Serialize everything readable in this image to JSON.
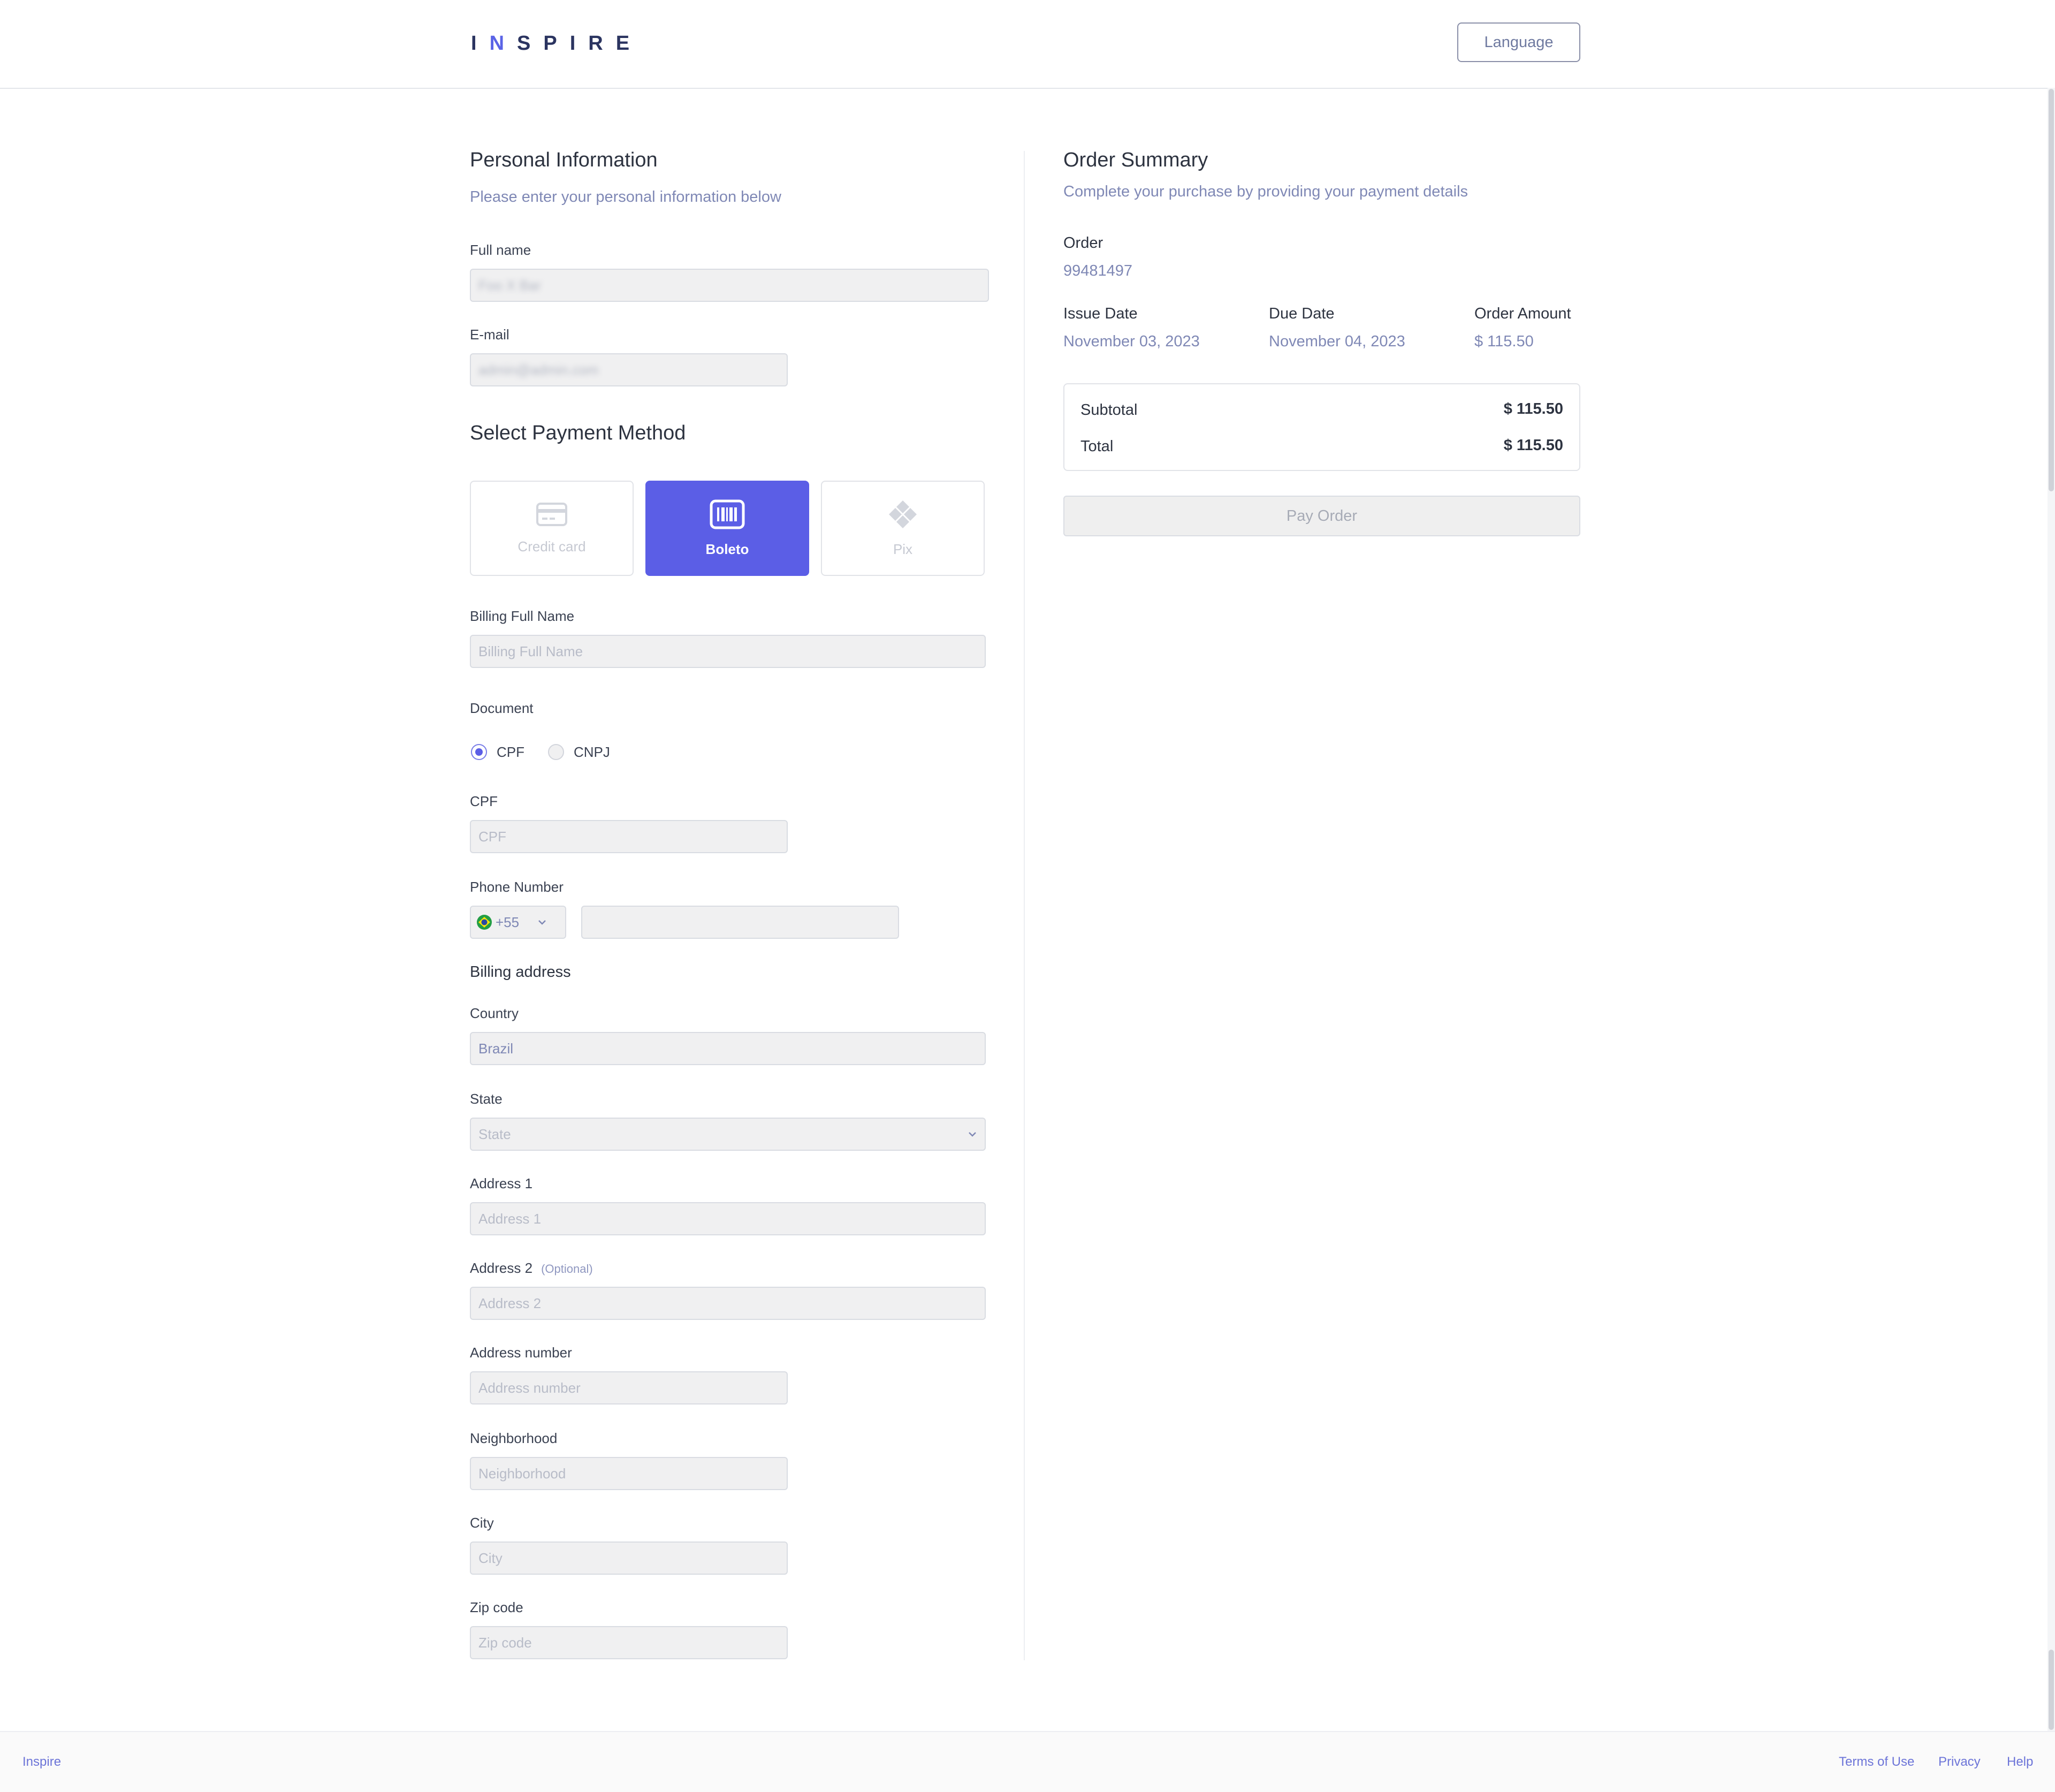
{
  "header": {
    "logo_part1": "I",
    "logo_accent": "N",
    "logo_part2": "SPIRE",
    "language_label": "Language"
  },
  "personal": {
    "title": "Personal Information",
    "subtitle": "Please enter your personal information below",
    "fullname_label": "Full name",
    "fullname_value": "Foo X Bar",
    "email_label": "E-mail",
    "email_value": "admin@admin.com"
  },
  "payment": {
    "title": "Select Payment Method",
    "methods": [
      {
        "label": "Credit card",
        "icon": "credit-card-icon",
        "selected": false
      },
      {
        "label": "Boleto",
        "icon": "barcode-icon",
        "selected": true
      },
      {
        "label": "Pix",
        "icon": "pix-icon",
        "selected": false
      }
    ],
    "accent_color": "#5b5ee6"
  },
  "billing": {
    "fullname_label": "Billing Full Name",
    "fullname_placeholder": "Billing Full Name",
    "document_label": "Document",
    "doc_options": [
      "CPF",
      "CNPJ"
    ],
    "cpf_label": "CPF",
    "cpf_placeholder": "CPF",
    "phone_label": "Phone Number",
    "phone_code": "+55",
    "phone_placeholder": "",
    "address_title": "Billing address",
    "country_label": "Country",
    "country_value": "Brazil",
    "state_label": "State",
    "state_placeholder": "State",
    "address1_label": "Address 1",
    "address1_placeholder": "Address 1",
    "address2_label": "Address 2",
    "address2_optional": "(Optional)",
    "address2_placeholder": "Address 2",
    "address_number_label": "Address number",
    "address_number_placeholder": "Address number",
    "neighborhood_label": "Neighborhood",
    "neighborhood_placeholder": "Neighborhood",
    "city_label": "City",
    "city_placeholder": "City",
    "zip_label": "Zip code",
    "zip_placeholder": "Zip code"
  },
  "order": {
    "title": "Order Summary",
    "subtitle": "Complete your purchase by providing your payment details",
    "order_label": "Order",
    "order_number": "99481497",
    "issue_label": "Issue Date",
    "issue_value": "November 03, 2023",
    "due_label": "Due Date",
    "due_value": "November 04, 2023",
    "amount_label": "Order Amount",
    "amount_value": "$ 115.50",
    "subtotal_label": "Subtotal",
    "subtotal_value": "$ 115.50",
    "total_label": "Total",
    "total_value": "$ 115.50",
    "pay_label": "Pay Order"
  },
  "footer": {
    "brand": "Inspire",
    "terms": "Terms of Use",
    "privacy": "Privacy",
    "help": "Help"
  }
}
